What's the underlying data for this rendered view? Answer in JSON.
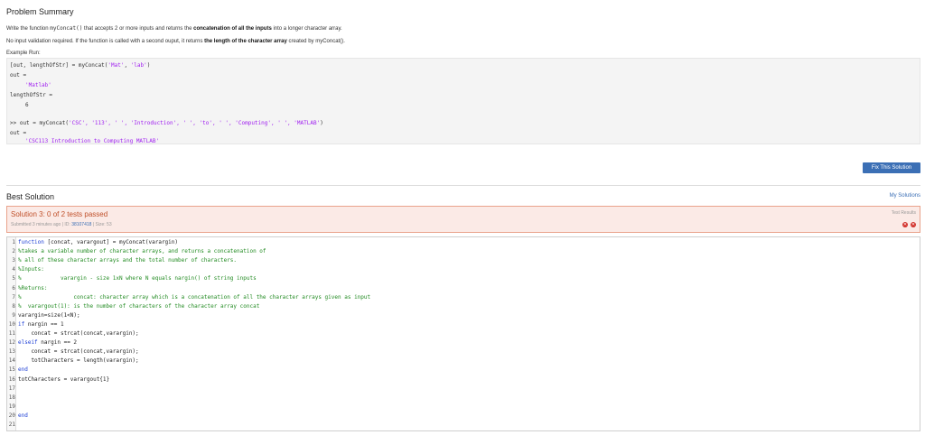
{
  "problem": {
    "title": "Problem Summary",
    "line1_pre": "Write the function ",
    "line1_fn": "myConcat()",
    "line1_mid": " that accepts 2 or more inputs and returns the ",
    "line1_bold": "concatenation of all the inputs",
    "line1_post": " into a longer character array.",
    "line2_pre": "No input validation required. If the function is called with a second ouput, it returns ",
    "line2_bold": "the length of the character array",
    "line2_post": " created by myConcat().",
    "example_label": "Example Run:"
  },
  "example": {
    "l1_a": "[out, lengthOfStr] = myConcat(",
    "l1_s1": "'Mat'",
    "l1_b": ", ",
    "l1_s2": "'lab'",
    "l1_c": ")",
    "l2": "out =",
    "l3": "'Matlab'",
    "l4": "lengthOfStr =",
    "l5": "6",
    "l6_a": ">> out = myConcat(",
    "l6_s": "'CSC', '113', ' ', 'Introduction', ' ', 'to', ' ', 'Computing', ' ', 'MATLAB'",
    "l6_c": ")",
    "l7": "out =",
    "l8": "'CSC113 Introduction to Computing MATLAB'"
  },
  "fix_button": "Fix This Solution",
  "best": {
    "title": "Best Solution",
    "my_solutions": "My Solutions"
  },
  "result": {
    "title": "Solution 3: 0 of 2 tests passed",
    "submitted": "Submitted 3 minutes ago",
    "sep1": "|",
    "id_label": "ID:",
    "id_value": "38107418",
    "sep2": "|",
    "size": "Size: 53",
    "test_results": "Test Results",
    "x1": "✕",
    "x2": "✕"
  },
  "code": [
    {
      "n": "1",
      "kw": "function",
      "t": " [concat, varargout] = myConcat(varargin)"
    },
    {
      "n": "2",
      "cm": "%takes a variable number of character arrays, and returns a concatenation of"
    },
    {
      "n": "3",
      "cm": "% all of these character arrays and the total number of characters."
    },
    {
      "n": "4",
      "cm": "%Inputs:"
    },
    {
      "n": "5",
      "cm": "%            varargin - size 1xN where N equals nargin() of string inputs"
    },
    {
      "n": "6",
      "cm": "%Returns:"
    },
    {
      "n": "7",
      "cm": "%                concat: character array which is a concatenation of all the character arrays given as input"
    },
    {
      "n": "8",
      "cm": "%  varargout(1): is the number of characters of the character array concat"
    },
    {
      "n": "9",
      "t": "varargin=size(1<N);"
    },
    {
      "n": "10",
      "kw": "if",
      "t": " nargin == 1"
    },
    {
      "n": "11",
      "t": "    concat = strcat(concat,varargin);"
    },
    {
      "n": "12",
      "kw": "elseif",
      "t": " nargin == 2"
    },
    {
      "n": "13",
      "t": "    concat = strcat(concat,varargin);"
    },
    {
      "n": "14",
      "t": "    totCharacters = length(varargin);"
    },
    {
      "n": "15",
      "kw": "end",
      "t": ""
    },
    {
      "n": "16",
      "t": "totCharacters = varargout{1}"
    },
    {
      "n": "17",
      "t": ""
    },
    {
      "n": "18",
      "t": ""
    },
    {
      "n": "19",
      "t": ""
    },
    {
      "n": "20",
      "kw": "end",
      "t": ""
    },
    {
      "n": "21",
      "t": ""
    }
  ]
}
